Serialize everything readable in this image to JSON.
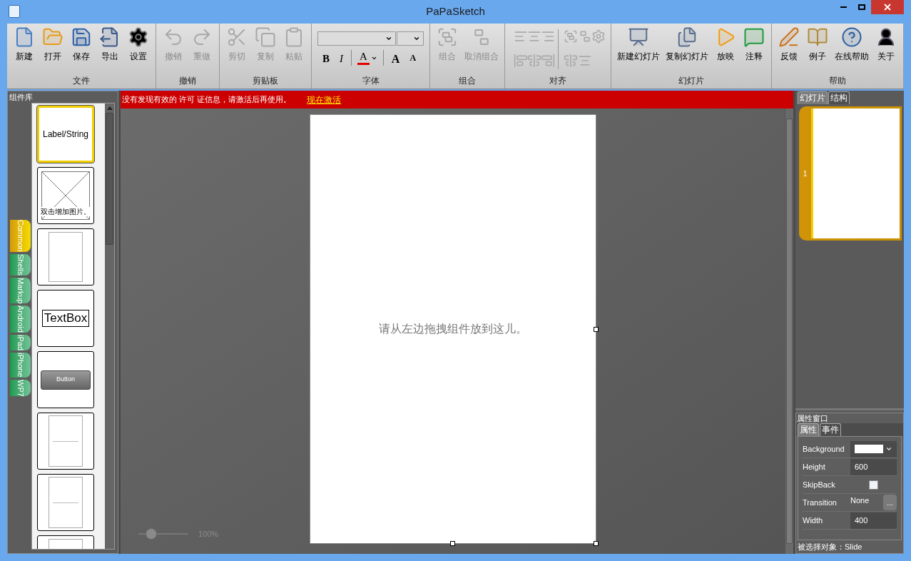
{
  "window": {
    "title": "PaPaSketch"
  },
  "ribbon": {
    "groups": [
      {
        "kind": "buttons",
        "label": "文件",
        "buttons": [
          {
            "label": "新建",
            "disabled": false
          },
          {
            "label": "打开",
            "disabled": false
          },
          {
            "label": "保存",
            "disabled": false
          },
          {
            "label": "导出",
            "disabled": false
          },
          {
            "label": "设置",
            "disabled": false
          }
        ]
      },
      {
        "kind": "buttons",
        "label": "撤销",
        "buttons": [
          {
            "label": "撤销",
            "disabled": true
          },
          {
            "label": "重做",
            "disabled": true
          }
        ]
      },
      {
        "kind": "buttons",
        "label": "剪贴板",
        "buttons": [
          {
            "label": "剪切",
            "disabled": true
          },
          {
            "label": "复制",
            "disabled": true
          },
          {
            "label": "粘贴",
            "disabled": true
          }
        ]
      },
      {
        "kind": "font",
        "label": "字体",
        "buttons": [
          {
            "label": "B"
          },
          {
            "label": "I"
          },
          {
            "label": "A"
          },
          {
            "label": "A"
          },
          {
            "label": "A"
          }
        ]
      },
      {
        "kind": "buttons",
        "label": "组合",
        "buttons": [
          {
            "label": "组合",
            "disabled": true
          },
          {
            "label": "取消组合",
            "disabled": true
          }
        ]
      },
      {
        "kind": "align",
        "label": "对齐"
      },
      {
        "kind": "buttons",
        "label": "幻灯片",
        "buttons": [
          {
            "label": "新建幻灯片",
            "disabled": false
          },
          {
            "label": "复制幻灯片",
            "disabled": false
          },
          {
            "label": "放映",
            "disabled": false
          },
          {
            "label": "注释",
            "disabled": false
          }
        ]
      },
      {
        "kind": "buttons",
        "label": "帮助",
        "buttons": [
          {
            "label": "反馈",
            "disabled": false
          },
          {
            "label": "例子",
            "disabled": false
          },
          {
            "label": "在线帮助",
            "disabled": false
          },
          {
            "label": "关于",
            "disabled": false
          }
        ]
      }
    ]
  },
  "library": {
    "title": "组件库",
    "tabs": [
      {
        "label": "Common",
        "selected": true
      },
      {
        "label": "Shells",
        "selected": false
      },
      {
        "label": "Markup",
        "selected": false
      },
      {
        "label": "Android",
        "selected": false
      },
      {
        "label": "iPad",
        "selected": false
      },
      {
        "label": "iPhone",
        "selected": false
      },
      {
        "label": "WP7",
        "selected": false
      }
    ],
    "items": [
      {
        "kind": "label",
        "text": "Label/String",
        "selected": true
      },
      {
        "kind": "image",
        "text": "双击增加图片。",
        "selected": false
      },
      {
        "kind": "panel",
        "selected": false
      },
      {
        "kind": "textbox",
        "text": "TextBox",
        "selected": false
      },
      {
        "kind": "button",
        "text": "Button",
        "selected": false
      },
      {
        "kind": "page",
        "selected": false
      },
      {
        "kind": "page",
        "selected": false
      },
      {
        "kind": "panel",
        "selected": false
      }
    ]
  },
  "banner": {
    "message": "没有发现有效的 许可 证信息，请激活后再使用。",
    "link": "现在激活"
  },
  "canvas": {
    "placeholder": "请从左边拖拽组件放到这儿。",
    "zoom": {
      "level": 0.25,
      "reading": "100%"
    }
  },
  "slides": {
    "tabs": [
      {
        "label": "幻灯片",
        "selected": true
      },
      {
        "label": "结构",
        "selected": false
      }
    ],
    "items": [
      {
        "number": "1",
        "selected": true
      }
    ]
  },
  "properties": {
    "title": "属性窗口",
    "tabs": [
      {
        "label": "属性",
        "selected": true
      },
      {
        "label": "事件",
        "selected": false
      }
    ],
    "rows": [
      {
        "kind": "color",
        "name": "Background",
        "color": "#ffffff"
      },
      {
        "kind": "text",
        "name": "Height",
        "value": "600"
      },
      {
        "kind": "checkbox",
        "name": "SkipBack",
        "checked": false
      },
      {
        "kind": "select",
        "name": "Transition",
        "value": "None",
        "button": "..."
      },
      {
        "kind": "text",
        "name": "Width",
        "value": "400"
      }
    ],
    "footer": "被选择对象：Slide"
  }
}
